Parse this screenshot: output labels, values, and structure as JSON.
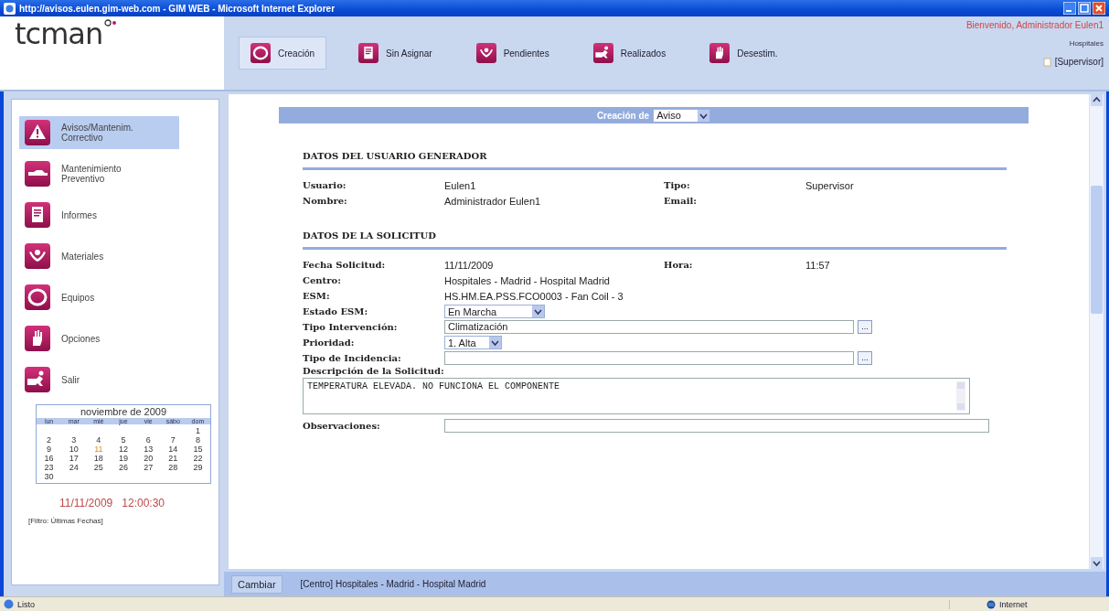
{
  "window": {
    "title": "http://avisos.eulen.gim-web.com - GIM WEB - Microsoft Internet Explorer"
  },
  "header": {
    "logo": "tcman",
    "welcome": "Bienvenido, Administrador Eulen1",
    "group": "Hospitales",
    "role": "[Supervisor]"
  },
  "nav_tabs": [
    {
      "label": "Creación",
      "selected": true
    },
    {
      "label": "Sin Asignar",
      "selected": false
    },
    {
      "label": "Pendientes",
      "selected": false
    },
    {
      "label": "Realizados",
      "selected": false
    },
    {
      "label": "Desestim.",
      "selected": false
    }
  ],
  "sidebar": {
    "items": [
      {
        "label": "Avisos/Mantenim. Correctivo",
        "selected": true
      },
      {
        "label": "Mantenimiento Preventivo",
        "selected": false
      },
      {
        "label": "Informes",
        "selected": false
      },
      {
        "label": "Materiales",
        "selected": false
      },
      {
        "label": "Equipos",
        "selected": false
      },
      {
        "label": "Opciones",
        "selected": false
      },
      {
        "label": "Salir",
        "selected": false
      }
    ]
  },
  "calendar": {
    "title": "noviembre de 2009",
    "weekdays": [
      "lun",
      "mar",
      "mié",
      "jue",
      "vie",
      "sábo",
      "dom"
    ],
    "weeks": [
      [
        {
          "day": "1",
          "today": false
        }
      ],
      [
        {
          "day": "2",
          "today": false
        },
        {
          "day": "3",
          "today": false
        },
        {
          "day": "4",
          "today": false
        },
        {
          "day": "5",
          "today": false
        },
        {
          "day": "6",
          "today": false
        },
        {
          "day": "7",
          "today": false
        },
        {
          "day": "8",
          "today": false
        }
      ],
      [
        {
          "day": "9",
          "today": false
        },
        {
          "day": "10",
          "today": false
        },
        {
          "day": "11",
          "today": true
        },
        {
          "day": "12",
          "today": false
        },
        {
          "day": "13",
          "today": false
        },
        {
          "day": "14",
          "today": false
        },
        {
          "day": "15",
          "today": false
        }
      ],
      [
        {
          "day": "16",
          "today": false
        },
        {
          "day": "17",
          "today": false
        },
        {
          "day": "18",
          "today": false
        },
        {
          "day": "19",
          "today": false
        },
        {
          "day": "20",
          "today": false
        },
        {
          "day": "21",
          "today": false
        },
        {
          "day": "22",
          "today": false
        }
      ],
      [
        {
          "day": "23",
          "today": false
        },
        {
          "day": "24",
          "today": false
        },
        {
          "day": "25",
          "today": false
        },
        {
          "day": "26",
          "today": false
        },
        {
          "day": "27",
          "today": false
        },
        {
          "day": "28",
          "today": false
        },
        {
          "day": "29",
          "today": false
        }
      ],
      [
        {
          "day": "30",
          "today": false
        }
      ]
    ]
  },
  "clock": "11/11/2009   12:00:30",
  "filter": "[Filtro: Últimas Fechas]",
  "creation_bar": {
    "label": "Creación de",
    "value": "Aviso"
  },
  "sections": [
    {
      "title": "DATOS DEL USUARIO GENERADOR",
      "rows": [
        {
          "kind": "pairs",
          "fields": [
            {
              "label": "Usuario:",
              "value": "Eulen1"
            },
            {
              "label": "Tipo:",
              "value": "Supervisor"
            }
          ]
        },
        {
          "kind": "pairs",
          "fields": [
            {
              "label": "Nombre:",
              "value": "Administrador  Eulen1"
            },
            {
              "label": "Email:"
            }
          ]
        }
      ]
    },
    {
      "title": "DATOS DE LA SOLICITUD",
      "rows": [
        {
          "kind": "pairs",
          "fields": [
            {
              "label": "Fecha Solicitud:",
              "value": "11/11/2009"
            },
            {
              "label": "Hora:",
              "value": "11:57"
            }
          ]
        },
        {
          "kind": "text",
          "label": "Centro:",
          "value": "Hospitales - Madrid - Hospital Madrid"
        },
        {
          "kind": "text",
          "label": "ESM:",
          "value": "HS.HM.EA.PSS.FCO0003 - Fan Coil - 3"
        },
        {
          "kind": "select",
          "label": "Estado ESM:",
          "value": "En Marcha"
        },
        {
          "kind": "lookup",
          "label": "Tipo Intervención:",
          "value": "Climatización",
          "button": "..."
        },
        {
          "kind": "select",
          "label": "Prioridad:",
          "value": "1. Alta"
        },
        {
          "kind": "lookup",
          "label": "Tipo de Incidencia:",
          "button": "..."
        },
        {
          "kind": "textarea",
          "label": "Descripción de la Solicitud:",
          "value": "TEMPERATURA ELEVADA. NO FUNCIONA EL COMPONENTE"
        },
        {
          "kind": "input",
          "label": "Observaciones:"
        }
      ]
    }
  ],
  "footer": {
    "button": "Cambiar",
    "info": "[Centro] Hospitales - Madrid - Hospital Madrid"
  },
  "status_bar": {
    "status": "Listo",
    "zone": "Internet"
  }
}
